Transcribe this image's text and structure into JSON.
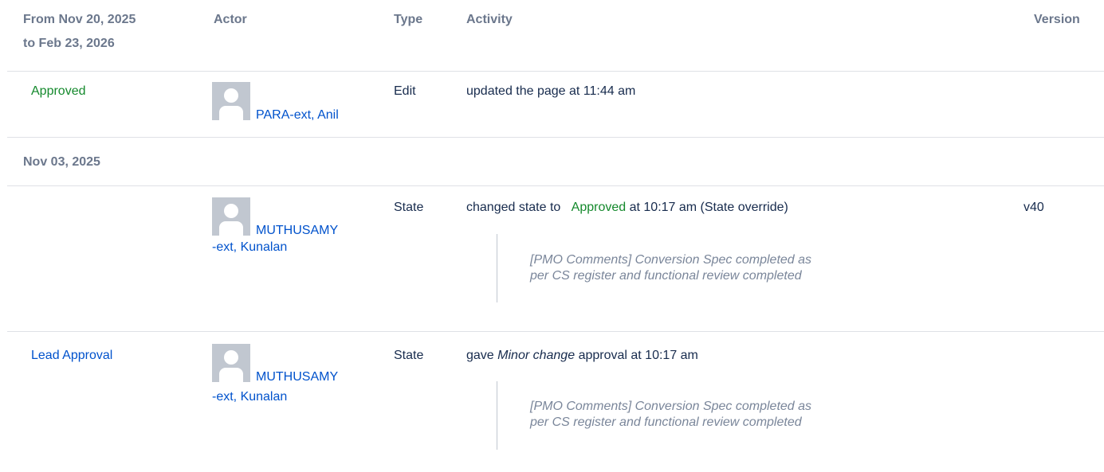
{
  "columns": {
    "date_range_line1": "From Nov 20, 2025",
    "date_range_line2": "to Feb 23, 2026",
    "actor": "Actor",
    "type": "Type",
    "activity": "Activity",
    "version": "Version"
  },
  "rows": [
    {
      "state": "Approved",
      "actor": "PARA-ext, Anil",
      "type": "Edit",
      "activity": "updated the page at 11:44 am"
    }
  ],
  "group2": {
    "date": "Nov 03, 2025"
  },
  "rows2": [
    {
      "actor_line1": "MUTHUSAMY",
      "actor_line2": "-ext, Kunalan",
      "type": "State",
      "activity_prefix": "changed state to",
      "activity_state": "Approved",
      "activity_suffix": "at 10:17 am (State override)",
      "comment_line1": "[PMO Comments] Conversion Spec completed as",
      "comment_line2": "per CS register and functional review completed",
      "version": "v40"
    },
    {
      "state": "Lead Approval",
      "actor_line1": "MUTHUSAMY",
      "actor_line2": "-ext, Kunalan",
      "type": "State",
      "activity_prefix": "gave",
      "activity_emph": "Minor change",
      "activity_suffix": "approval at 10:17 am",
      "comment_line1": "[PMO Comments] Conversion Spec completed as",
      "comment_line2": "per CS register and functional review completed"
    }
  ],
  "icons": {
    "avatar": "default-user-avatar-icon"
  },
  "colors": {
    "state_green": "#14892c",
    "link_blue": "#0052cc",
    "header_gray": "#6b778c",
    "comment_gray": "#7a869a"
  }
}
